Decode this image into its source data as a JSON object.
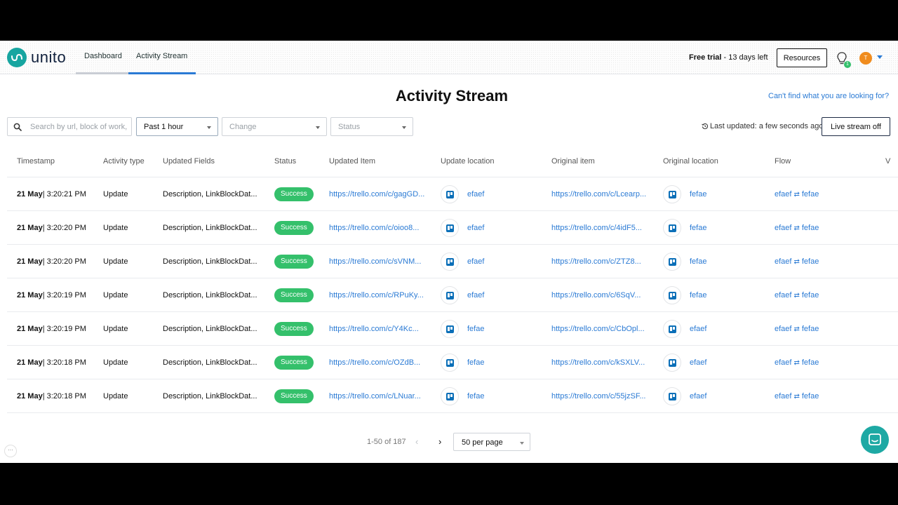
{
  "nav": {
    "brand": "unito",
    "dashboard": "Dashboard",
    "activity_stream": "Activity Stream",
    "free_trial_bold": "Free trial",
    "free_trial_rest": " - 13 days left",
    "resources": "Resources",
    "notification_count": "1",
    "avatar_initial": "T"
  },
  "page": {
    "title": "Activity Stream",
    "help_link": "Can't find what you are looking for?"
  },
  "filters": {
    "search_placeholder": "Search by url, block of work, flow",
    "time_range": "Past 1 hour",
    "change": "Change",
    "status": "Status",
    "last_updated": "Last updated: a few seconds ago",
    "live_stream": "Live stream off"
  },
  "table": {
    "headers": [
      "Timestamp",
      "Activity type",
      "Updated Fields",
      "Status",
      "Updated Item",
      "Update location",
      "Original item",
      "Original location",
      "Flow",
      "V"
    ],
    "rows": [
      {
        "date": "21 May",
        "time": " | 3:20:21 PM",
        "type": "Update",
        "fields": "Description, LinkBlockDat...",
        "status": "Success",
        "updated_item": "https://trello.com/c/gagGD...",
        "update_location": "efaef",
        "original_item": "https://trello.com/c/Lcearp...",
        "original_location": "fefae",
        "flow_a": "efaef",
        "flow_b": "fefae"
      },
      {
        "date": "21 May",
        "time": " | 3:20:20 PM",
        "type": "Update",
        "fields": "Description, LinkBlockDat...",
        "status": "Success",
        "updated_item": "https://trello.com/c/oioo8...",
        "update_location": "efaef",
        "original_item": "https://trello.com/c/4idF5...",
        "original_location": "fefae",
        "flow_a": "efaef",
        "flow_b": "fefae"
      },
      {
        "date": "21 May",
        "time": " | 3:20:20 PM",
        "type": "Update",
        "fields": "Description, LinkBlockDat...",
        "status": "Success",
        "updated_item": "https://trello.com/c/sVNM...",
        "update_location": "efaef",
        "original_item": "https://trello.com/c/ZTZ8...",
        "original_location": "fefae",
        "flow_a": "efaef",
        "flow_b": "fefae"
      },
      {
        "date": "21 May",
        "time": " | 3:20:19 PM",
        "type": "Update",
        "fields": "Description, LinkBlockDat...",
        "status": "Success",
        "updated_item": "https://trello.com/c/RPuKy...",
        "update_location": "efaef",
        "original_item": "https://trello.com/c/6SqV...",
        "original_location": "fefae",
        "flow_a": "efaef",
        "flow_b": "fefae"
      },
      {
        "date": "21 May",
        "time": " | 3:20:19 PM",
        "type": "Update",
        "fields": "Description, LinkBlockDat...",
        "status": "Success",
        "updated_item": "https://trello.com/c/Y4Kc...",
        "update_location": "fefae",
        "original_item": "https://trello.com/c/CbOpl...",
        "original_location": "efaef",
        "flow_a": "efaef",
        "flow_b": "fefae"
      },
      {
        "date": "21 May",
        "time": " | 3:20:18 PM",
        "type": "Update",
        "fields": "Description, LinkBlockDat...",
        "status": "Success",
        "updated_item": "https://trello.com/c/OZdB...",
        "update_location": "fefae",
        "original_item": "https://trello.com/c/kSXLV...",
        "original_location": "efaef",
        "flow_a": "efaef",
        "flow_b": "fefae"
      },
      {
        "date": "21 May",
        "time": " | 3:20:18 PM",
        "type": "Update",
        "fields": "Description, LinkBlockDat...",
        "status": "Success",
        "updated_item": "https://trello.com/c/LNuar...",
        "update_location": "fefae",
        "original_item": "https://trello.com/c/55jzSF...",
        "original_location": "efaef",
        "flow_a": "efaef",
        "flow_b": "fefae"
      }
    ]
  },
  "pagination": {
    "range": "1-50 of 187",
    "per_page": "50 per page"
  },
  "colors": {
    "brand": "#17a5a0",
    "link": "#2a7ad4",
    "success": "#34c06b",
    "avatar": "#f08c1e"
  },
  "icons": [
    "search-icon",
    "chevron-down-icon",
    "lightbulb-icon",
    "history-icon",
    "trello-icon",
    "sync-arrows-icon",
    "chevron-left-icon",
    "chevron-right-icon",
    "chat-icon"
  ]
}
